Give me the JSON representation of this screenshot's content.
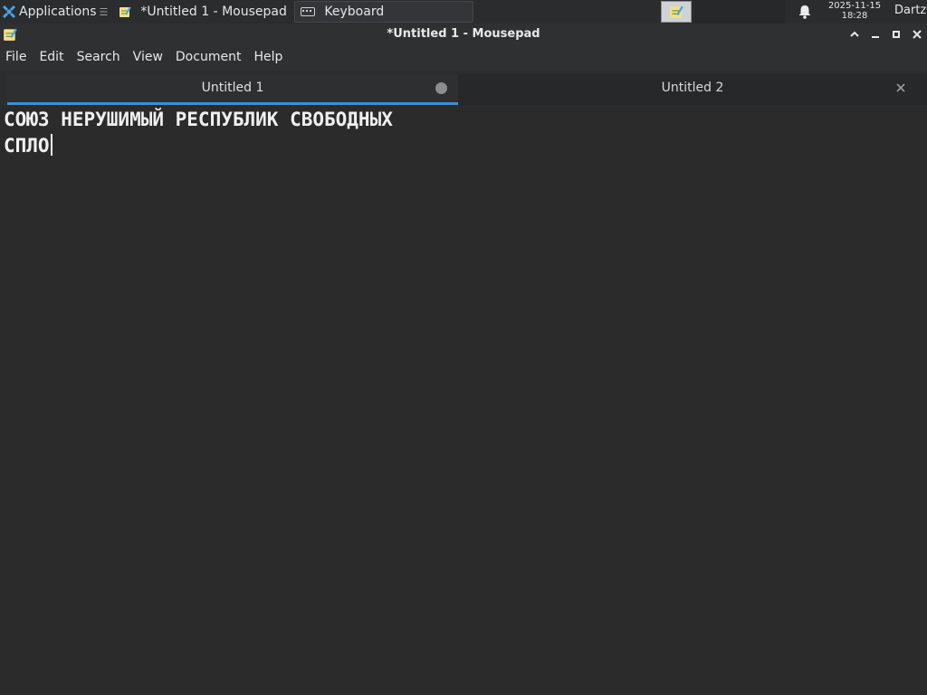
{
  "panel": {
    "applications_label": "Applications",
    "applications_icon": "xfce-logo-icon",
    "tasks": [
      {
        "label": "*Untitled 1 - Mousepad",
        "icon": "notepad-icon"
      },
      {
        "label": "Keyboard",
        "icon": "keyboard-icon"
      }
    ],
    "tray_icon": "notepad-icon",
    "notification_icon": "bell-icon",
    "clock": {
      "date": "2025-11-15",
      "time": "18:28"
    },
    "user": "Dartz"
  },
  "window": {
    "title": "*Untitled 1 - Mousepad",
    "icon": "notepad-icon",
    "controls": [
      "chevron-up-icon",
      "minimize-icon",
      "maximize-icon",
      "close-icon"
    ]
  },
  "menubar": {
    "items": [
      "File",
      "Edit",
      "Search",
      "View",
      "Document",
      "Help"
    ]
  },
  "tabs": [
    {
      "label": "Untitled 1",
      "active": true,
      "modified": true
    },
    {
      "label": "Untitled 2",
      "active": false,
      "modified": false
    }
  ],
  "editor": {
    "lines": [
      "СОЮЗ НЕРУШИМЫЙ РЕСПУБЛИК СВОБОДНЫХ",
      "СПЛО"
    ]
  },
  "colors": {
    "accent": "#3d8fd8",
    "background": "#2b2b2b",
    "text": "#f0f0f0"
  }
}
